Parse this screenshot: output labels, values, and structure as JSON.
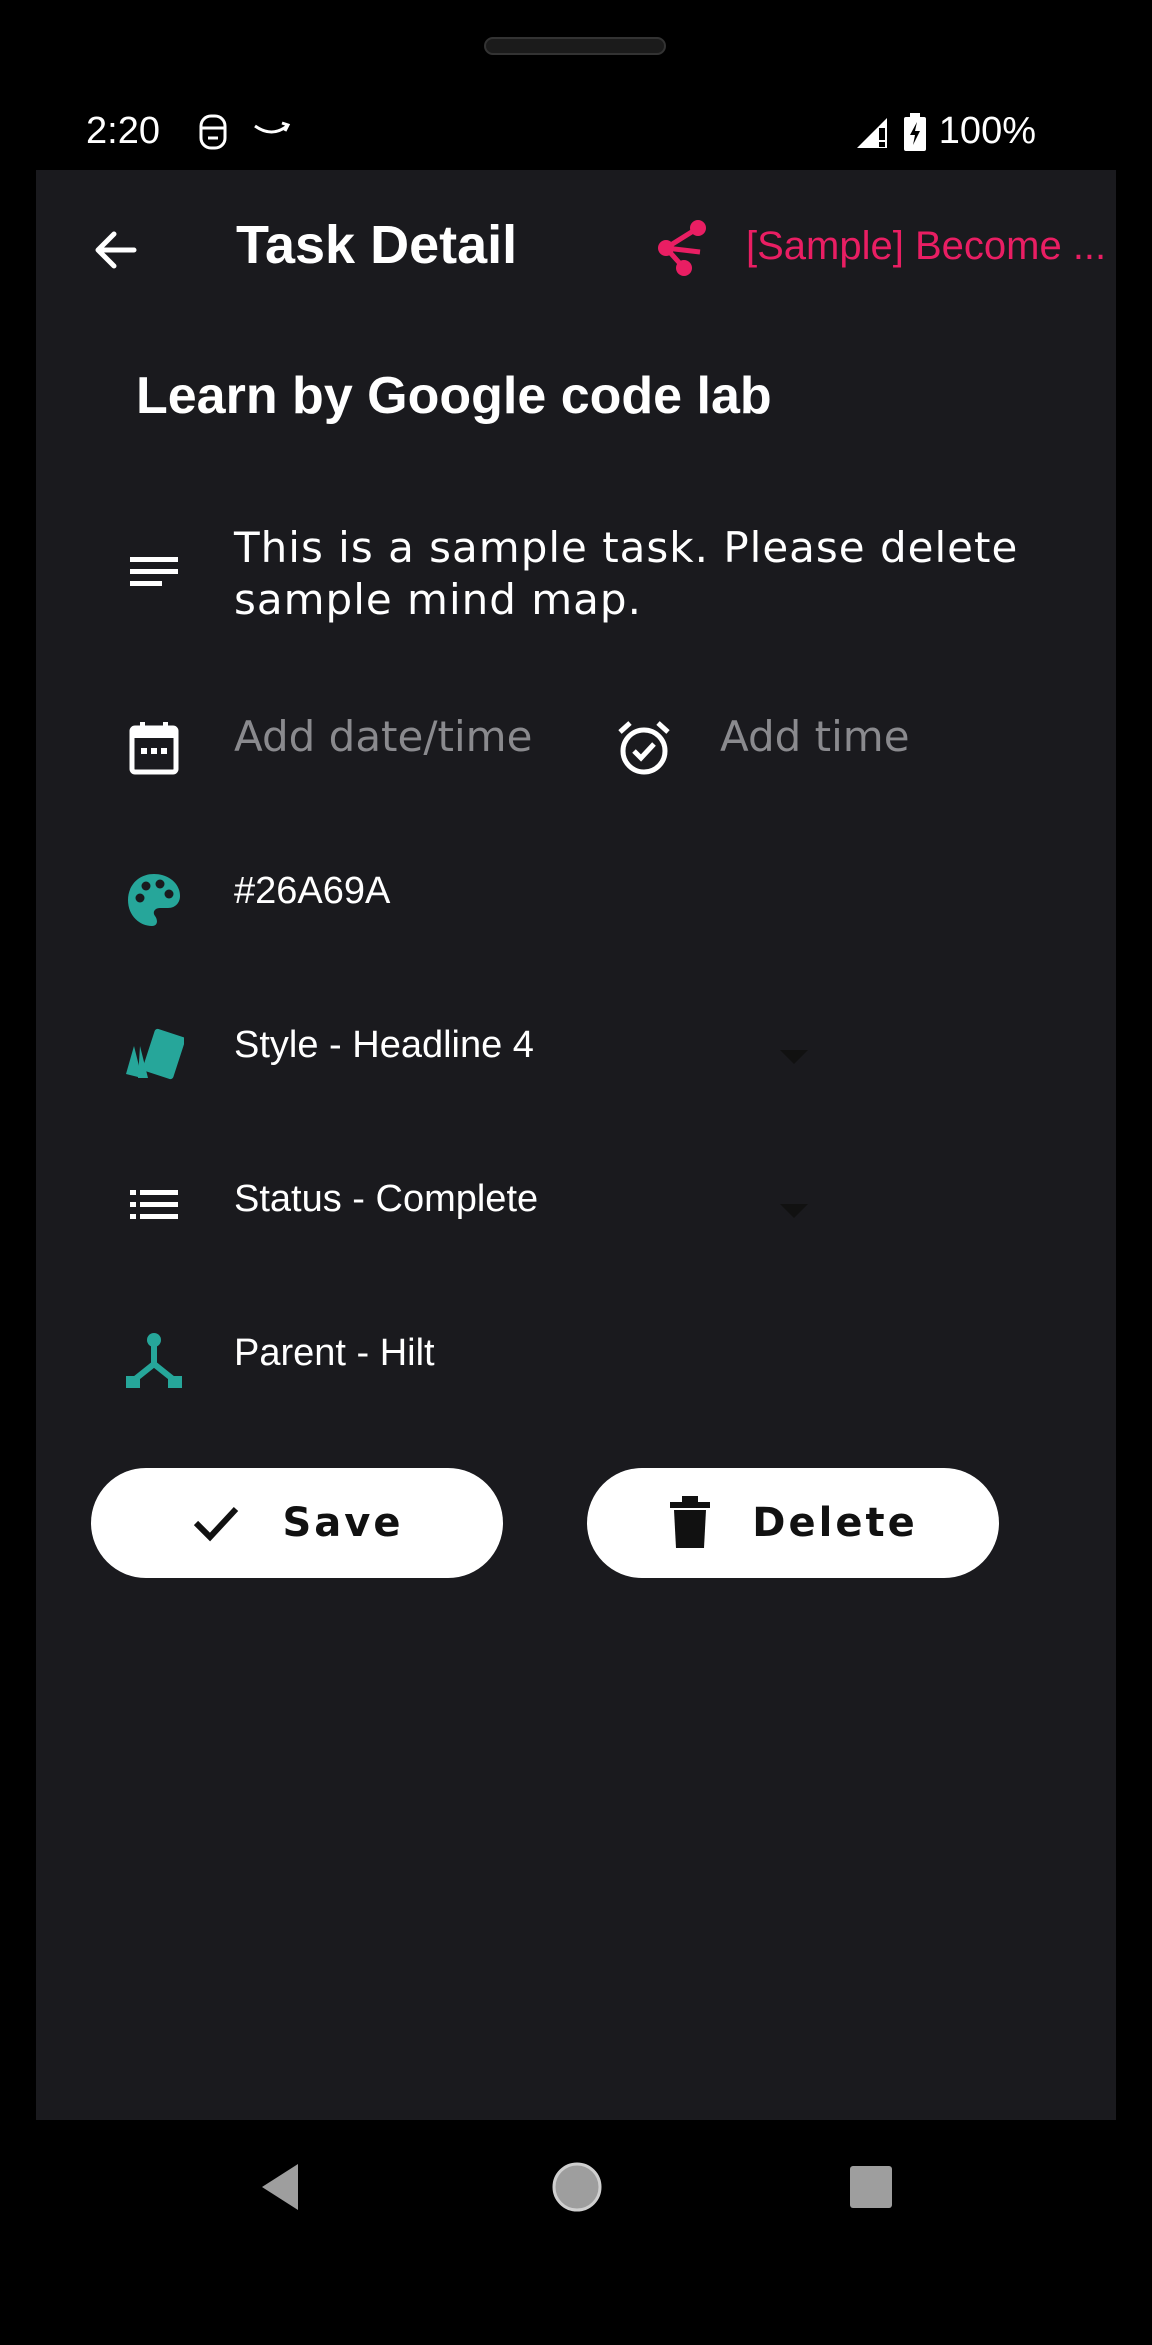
{
  "status_bar": {
    "time": "2:20",
    "battery": "100%",
    "icons": [
      "face-icon",
      "amazon-smile-icon",
      "signal-icon",
      "battery-charging-icon"
    ]
  },
  "app_bar": {
    "title": "Task Detail",
    "mind_map_link": "[Sample] Become ...",
    "accent_color": "#e91e63"
  },
  "task": {
    "title": "Learn by Google code lab",
    "description": "This is a sample task. Please delete sample mind map.",
    "date_placeholder": "Add date/time",
    "time_placeholder": "Add time",
    "color_value": "#26A69A",
    "style_label": "Style - Headline 4",
    "status_label": "Status - Complete",
    "parent_label": "Parent - Hilt"
  },
  "actions": {
    "save_label": "Save",
    "delete_label": "Delete"
  },
  "colors": {
    "background": "#1a1a1e",
    "icon_teal": "#26a69a",
    "text": "#ffffff"
  }
}
